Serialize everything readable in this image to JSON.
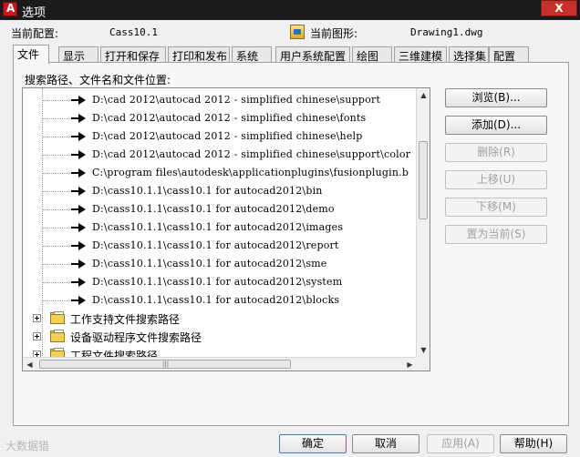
{
  "window": {
    "title": "选项",
    "close": "X"
  },
  "profile": {
    "current_profile_label": "当前配置:",
    "current_profile_value": "Cass10.1",
    "current_drawing_label": "当前图形:",
    "current_drawing_value": "Drawing1.dwg"
  },
  "tabs": [
    {
      "label": "文件",
      "active": true
    },
    {
      "label": "显示"
    },
    {
      "label": "打开和保存"
    },
    {
      "label": "打印和发布"
    },
    {
      "label": "系统"
    },
    {
      "label": "用户系统配置"
    },
    {
      "label": "绘图"
    },
    {
      "label": "三维建模"
    },
    {
      "label": "选择集"
    },
    {
      "label": "配置"
    }
  ],
  "files": {
    "section_label": "搜索路径、文件名和文件位置:",
    "paths": [
      "D:\\cad 2012\\autocad 2012 - simplified chinese\\support",
      "D:\\cad 2012\\autocad 2012 - simplified chinese\\fonts",
      "D:\\cad 2012\\autocad 2012 - simplified chinese\\help",
      "D:\\cad 2012\\autocad 2012 - simplified chinese\\support\\color",
      "C:\\program files\\autodesk\\applicationplugins\\fusionplugin.b",
      "D:\\cass10.1.1\\cass10.1 for autocad2012\\bin",
      "D:\\cass10.1.1\\cass10.1 for autocad2012\\demo",
      "D:\\cass10.1.1\\cass10.1 for autocad2012\\images",
      "D:\\cass10.1.1\\cass10.1 for autocad2012\\report",
      "D:\\cass10.1.1\\cass10.1 for autocad2012\\sme",
      "D:\\cass10.1.1\\cass10.1 for autocad2012\\system",
      "D:\\cass10.1.1\\cass10.1 for autocad2012\\blocks"
    ],
    "folders": [
      "工作支持文件搜索路径",
      "设备驱动程序文件搜索路径",
      "工程文件搜索路径"
    ]
  },
  "side_buttons": [
    {
      "label": "浏览(B)...",
      "enabled": true
    },
    {
      "label": "添加(D)...",
      "enabled": true
    },
    {
      "label": "删除(R)",
      "enabled": false
    },
    {
      "label": "上移(U)",
      "enabled": false
    },
    {
      "label": "下移(M)",
      "enabled": false
    },
    {
      "label": "置为当前(S)",
      "enabled": false
    }
  ],
  "bottom_buttons": {
    "ok": "确定",
    "cancel": "取消",
    "apply": "应用(A)",
    "help": "帮助(H)"
  },
  "watermark": "大数据猎"
}
